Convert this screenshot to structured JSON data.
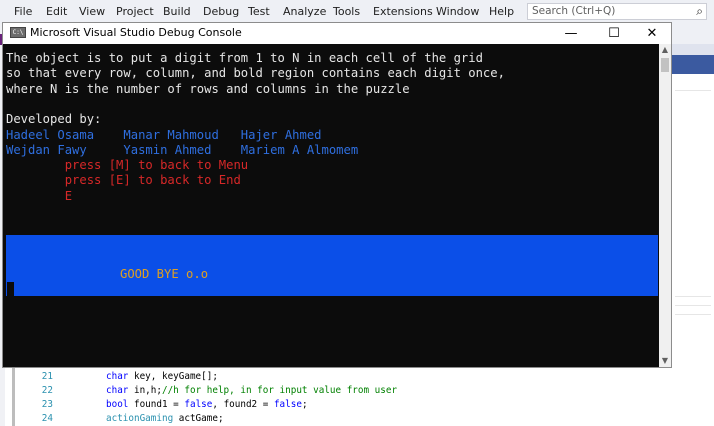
{
  "vs": {
    "menu": [
      "File",
      "Edit",
      "View",
      "Project",
      "Build",
      "Debug",
      "Test",
      "Analyze",
      "Tools",
      "Extensions",
      "Window",
      "Help"
    ],
    "search_placeholder": "Search (Ctrl+Q)",
    "search_icon": "search-icon",
    "code_lines": [
      {
        "num": "21",
        "parts": [
          {
            "t": "char",
            "c": "kw"
          },
          {
            "t": " key, keyGame[];",
            "c": "pl"
          }
        ]
      },
      {
        "num": "22",
        "parts": [
          {
            "t": "char",
            "c": "kw"
          },
          {
            "t": " in,h;",
            "c": "pl"
          },
          {
            "t": "//h for help, in for input value from user",
            "c": "cm"
          }
        ]
      },
      {
        "num": "23",
        "parts": [
          {
            "t": "bool",
            "c": "kw"
          },
          {
            "t": " found1 = ",
            "c": "pl"
          },
          {
            "t": "false",
            "c": "kw"
          },
          {
            "t": ", found2 = ",
            "c": "pl"
          },
          {
            "t": "false",
            "c": "kw"
          },
          {
            "t": ";",
            "c": "pl"
          }
        ]
      },
      {
        "num": "24",
        "parts": [
          {
            "t": "actionGaming",
            "c": "tp"
          },
          {
            "t": " actGame;",
            "c": "pl"
          }
        ]
      }
    ]
  },
  "console": {
    "title": "Microsoft Visual Studio Debug Console",
    "icon": "console-app-icon",
    "buttons": {
      "minimize": "—",
      "maximize": "☐",
      "close": "✕"
    },
    "lines": [
      {
        "text": "The object is to put a digit from 1 to N in each cell of the grid",
        "color": "white"
      },
      {
        "text": "so that every row, column, and bold region contains each digit once,",
        "color": "white"
      },
      {
        "text": "where N is the number of rows and columns in the puzzle",
        "color": "white"
      },
      {
        "text": "",
        "color": "white"
      },
      {
        "text": "Developed by:",
        "color": "white"
      },
      {
        "text": "Hadeel Osama    Manar Mahmoud   Hajer Ahmed",
        "color": "blue"
      },
      {
        "text": "Wejdan Fawy     Yasmin Ahmed    Mariem A Almomem",
        "color": "blue"
      },
      {
        "text": "        press [M] to back to Menu",
        "color": "red"
      },
      {
        "text": "        press [E] to back to End",
        "color": "red"
      },
      {
        "text": "        E",
        "color": "red"
      }
    ],
    "goodbye": "GOOD BYE o.o"
  },
  "colors": {
    "console_bg": "#0c0c0c",
    "goodbye_band": "#0b4fe8",
    "goodbye_text": "#e0a020",
    "developer_names": "#2f6fe0",
    "prompt_text": "#d62828"
  }
}
